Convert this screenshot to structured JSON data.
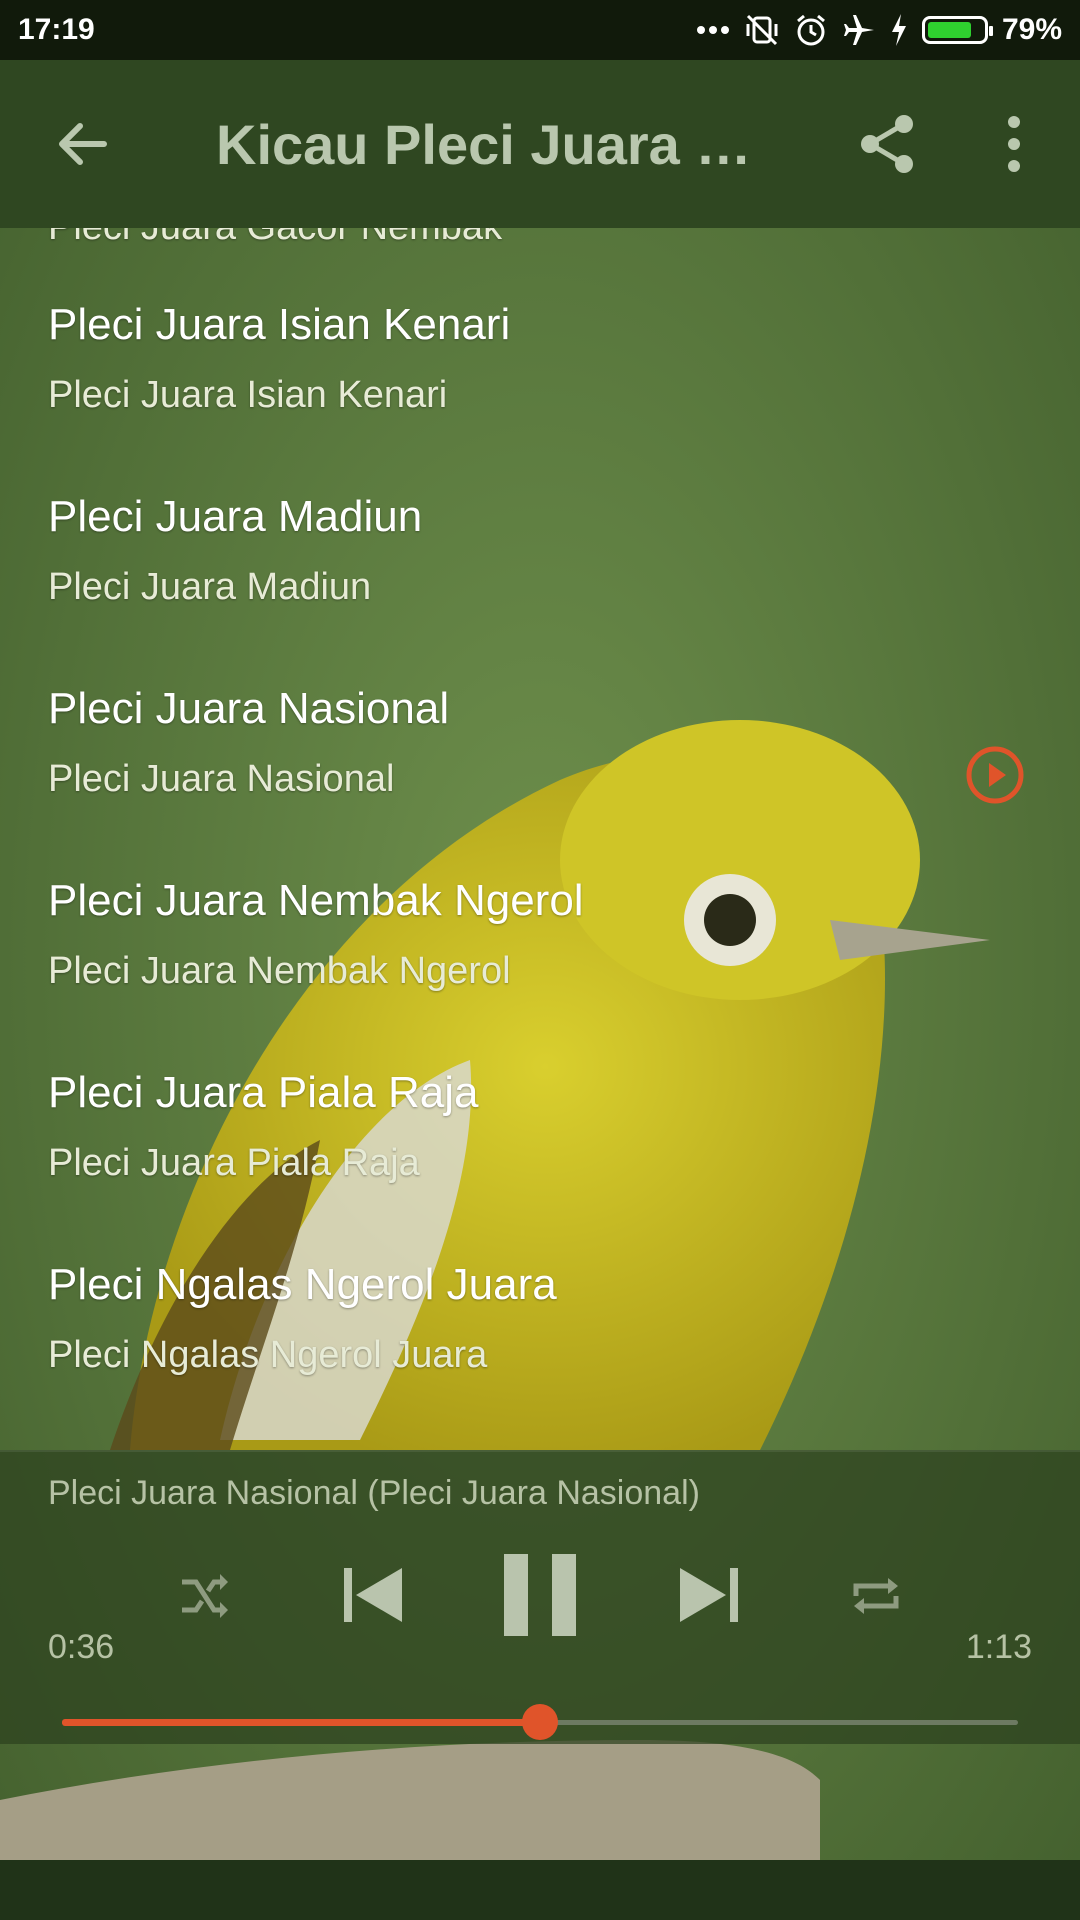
{
  "status_bar": {
    "time": "17:19",
    "battery_percent": "79%",
    "battery_level": 0.79,
    "icons": [
      "more-dots-icon",
      "vibrate-off-icon",
      "alarm-icon",
      "airplane-icon",
      "charging-icon",
      "battery-icon"
    ]
  },
  "app_bar": {
    "title": "Kicau Pleci Juara &...",
    "icons": [
      "back-arrow-icon",
      "share-icon",
      "overflow-menu-icon"
    ]
  },
  "songs": [
    {
      "title": "",
      "subtitle": "Pleci Juara Gacor Nembak"
    },
    {
      "title": "Pleci Juara Isian Kenari",
      "subtitle": "Pleci Juara Isian Kenari"
    },
    {
      "title": "Pleci Juara Madiun",
      "subtitle": "Pleci Juara Madiun"
    },
    {
      "title": "Pleci Juara Nasional",
      "subtitle": "Pleci Juara Nasional",
      "playing": true
    },
    {
      "title": "Pleci Juara Nembak Ngerol",
      "subtitle": "Pleci Juara Nembak Ngerol"
    },
    {
      "title": "Pleci Juara Piala Raja",
      "subtitle": "Pleci Juara Piala Raja"
    },
    {
      "title": "Pleci Ngalas Ngerol Juara",
      "subtitle": "Pleci Ngalas Ngerol Juara"
    }
  ],
  "player": {
    "now_playing": "Pleci Juara Nasional (Pleci Juara Nasional)",
    "elapsed": "0:36",
    "total": "1:13",
    "progress": 0.5,
    "controls": [
      "shuffle-icon",
      "previous-icon",
      "pause-icon",
      "next-icon",
      "repeat-icon"
    ]
  },
  "colors": {
    "accent": "#e0542a",
    "status_bar": "#111a0b",
    "app_bar": "#2f4721"
  }
}
